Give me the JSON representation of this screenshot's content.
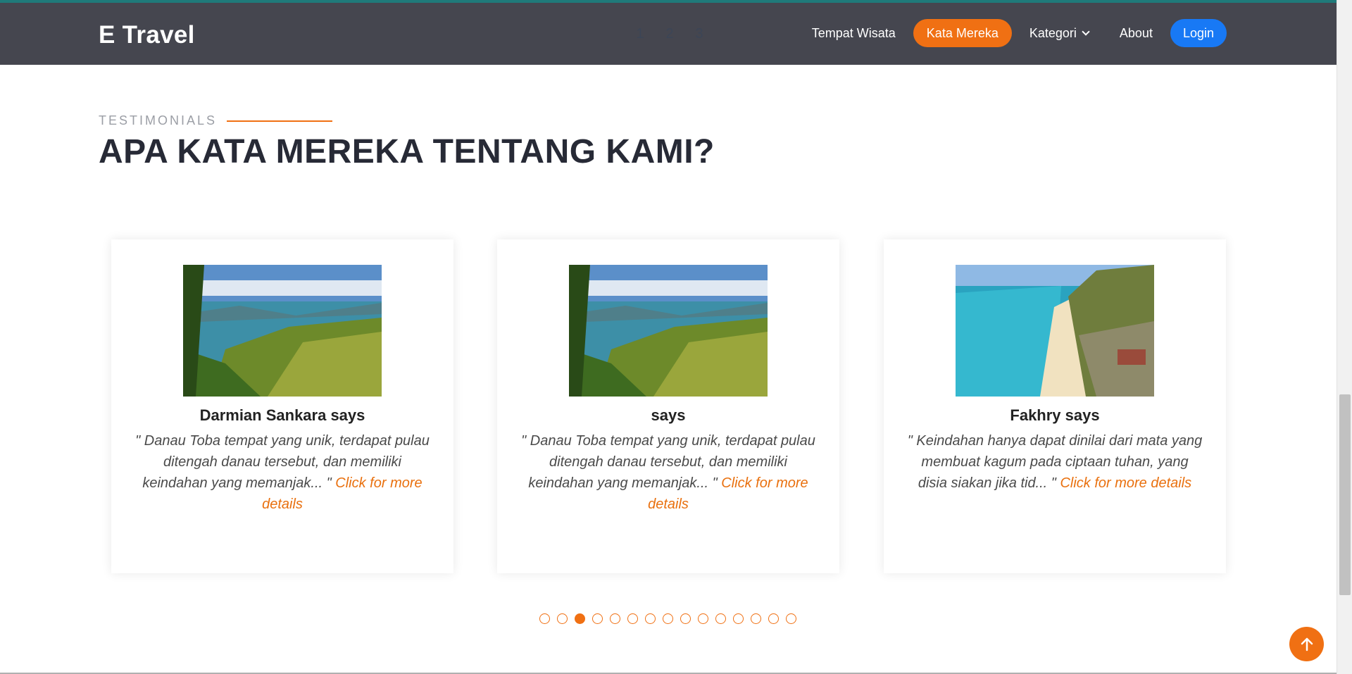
{
  "brand": "E Travel",
  "pager": [
    "1",
    "2",
    "3"
  ],
  "nav": {
    "tempat_wisata": "Tempat Wisata",
    "kata_mereka": "Kata Mereka",
    "kategori": "Kategori",
    "about": "About",
    "login": "Login"
  },
  "section": {
    "label": "TESTIMONIALS",
    "title": "APA KATA MEREKA TENTANG KAMI?"
  },
  "cards": [
    {
      "name": "Darmian Sankara says",
      "quote": "\" Danau Toba tempat yang unik, terdapat pulau ditengah danau tersebut, dan memiliki keindahan yang memanjak... \" ",
      "link": "Click for more details",
      "image": "lake-toba-photo"
    },
    {
      "name": "says",
      "quote": "\" Danau Toba tempat yang unik, terdapat pulau ditengah danau tersebut, dan memiliki keindahan yang memanjak... \" ",
      "link": "Click for more details",
      "image": "lake-toba-photo"
    },
    {
      "name": "Fakhry says",
      "quote": "\" Keindahan hanya dapat dinilai dari mata yang membuat kagum pada ciptaan tuhan, yang disia siakan jika tid... \" ",
      "link": "Click for more details",
      "image": "beach-cliff-photo"
    }
  ],
  "carousel": {
    "total_dots": 15,
    "active_index": 2
  },
  "colors": {
    "accent": "#f07013",
    "login": "#1879f5",
    "navbar": "#45464f"
  },
  "icons": {
    "back_to_top": "arrow-up-icon",
    "dropdown": "chevron-down-icon"
  }
}
